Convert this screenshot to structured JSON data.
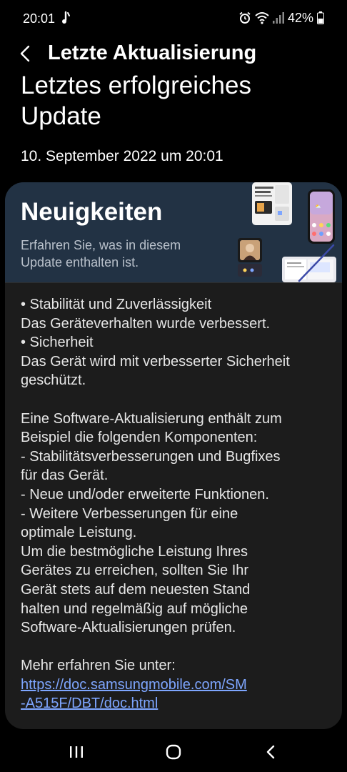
{
  "status_bar": {
    "time": "20:01",
    "battery_percent": "42%",
    "icons": [
      "notification-icon",
      "alarm-icon",
      "wifi-icon",
      "signal-icon",
      "battery-icon"
    ]
  },
  "header": {
    "title": "Letzte Aktualisierung",
    "back_icon": "back-arrow-icon"
  },
  "update": {
    "title": "Letztes erfolgreiches Update",
    "date": "10. September 2022 um 20:01"
  },
  "news": {
    "title": "Neuigkeiten",
    "subtitle": "Erfahren Sie, was in diesem Update enthalten ist."
  },
  "notes": {
    "l1": "• Stabilität und Zuverlässigkeit",
    "l2": "Das Geräteverhalten wurde verbessert.",
    "l3": "• Sicherheit",
    "l4": "Das Gerät wird mit verbesserter Sicherheit",
    "l5": "geschützt.",
    "l6": "Eine Software-Aktualisierung enthält zum",
    "l7": "Beispiel die folgenden Komponenten:",
    "l8": " - Stabilitätsverbesserungen und Bugfixes",
    "l9": "für das Gerät.",
    "l10": " - Neue und/oder erweiterte Funktionen.",
    "l11": " - Weitere Verbesserungen für eine",
    "l12": "optimale Leistung.",
    "l13": "Um die bestmögliche Leistung Ihres",
    "l14": "Gerätes zu erreichen, sollten Sie Ihr",
    "l15": "Gerät stets auf dem neuesten Stand",
    "l16": "halten und regelmäßig auf mögliche",
    "l17": "Software-Aktualisierungen prüfen.",
    "l18": "Mehr erfahren Sie unter:",
    "link1": "https://doc.samsungmobile.com/SM",
    "link2": "-A515F/DBT/doc.html"
  },
  "nav_bar": {
    "icons": [
      "recent-apps-icon",
      "home-icon",
      "back-icon"
    ]
  },
  "colors": {
    "background": "#000000",
    "card": "#1c1c1c",
    "banner": "#223244",
    "link": "#7ea6ff"
  }
}
